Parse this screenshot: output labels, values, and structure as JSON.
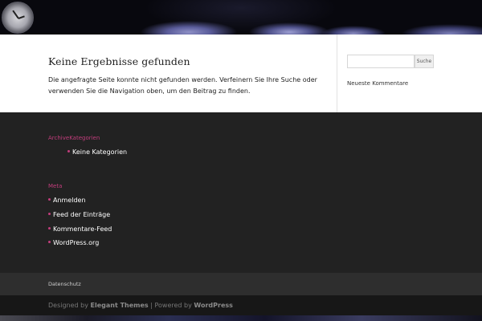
{
  "main": {
    "title": "Keine Ergebnisse gefunden",
    "text": "Die angefragte Seite konnte nicht gefunden werden. Verfeinern Sie Ihre Suche oder verwenden Sie die Navigation oben, um den Beitrag zu finden."
  },
  "sidebar": {
    "search_value": "",
    "search_button": "Suche",
    "recent_comments_title": "Neueste Kommentare"
  },
  "footer": {
    "widget1": {
      "title": "ArchiveKategorien",
      "items": [
        "Keine Kategorien"
      ]
    },
    "widget2": {
      "title": "Meta",
      "items": [
        "Anmelden",
        "Feed der Einträge",
        "Kommentare-Feed",
        "WordPress.org"
      ]
    }
  },
  "bottom_nav": {
    "link": "Datenschutz"
  },
  "credits": {
    "designed_by": "Designed by",
    "theme": "Elegant Themes",
    "separator": "|",
    "powered_by": "Powered by",
    "platform": "WordPress"
  },
  "colors": {
    "accent": "#c23d7c",
    "footer_bg": "#222222",
    "content_bg": "#ffffff"
  }
}
